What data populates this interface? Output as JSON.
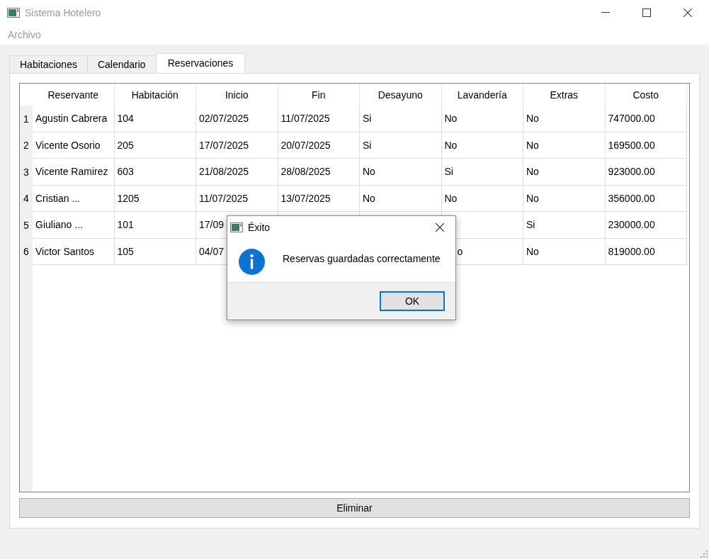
{
  "window": {
    "title": "Sistema Hotelero"
  },
  "menu": [
    "Archivo"
  ],
  "tabs": [
    {
      "label": "Habitaciones",
      "selected": false
    },
    {
      "label": "Calendario",
      "selected": false
    },
    {
      "label": "Reservaciones",
      "selected": true
    }
  ],
  "table": {
    "columns": [
      "Reservante",
      "Habitación",
      "Inicio",
      "Fin",
      "Desayuno",
      "Lavandería",
      "Extras",
      "Costo"
    ],
    "rows": [
      {
        "number": "1",
        "cells": [
          "Agustin Cabrera",
          "104",
          "02/07/2025",
          "11/07/2025",
          "Si",
          "No",
          "No",
          "747000.00"
        ]
      },
      {
        "number": "2",
        "cells": [
          "Vicente Osorio",
          "205",
          "17/07/2025",
          "20/07/2025",
          "Si",
          "No",
          "No",
          "169500.00"
        ]
      },
      {
        "number": "3",
        "cells": [
          "Vicente Ramirez",
          "603",
          "21/08/2025",
          "28/08/2025",
          "No",
          "Si",
          "No",
          "923000.00"
        ]
      },
      {
        "number": "4",
        "cells": [
          "Cristian ...",
          "1205",
          "11/07/2025",
          "13/07/2025",
          "No",
          "No",
          "No",
          "356000.00"
        ]
      },
      {
        "number": "5",
        "cells": [
          "Giuliano ...",
          "101",
          "17/09",
          null,
          null,
          null,
          "Si",
          "230000.00"
        ]
      },
      {
        "number": "6",
        "cells": [
          "Victor Santos",
          "105",
          "04/07",
          null,
          null,
          "o",
          "No",
          "819000.00"
        ]
      }
    ]
  },
  "buttons": [
    "Eliminar"
  ],
  "dialog": {
    "title": "Éxito",
    "message": "Reservas guardadas correctamente",
    "buttons": [
      "OK"
    ]
  }
}
